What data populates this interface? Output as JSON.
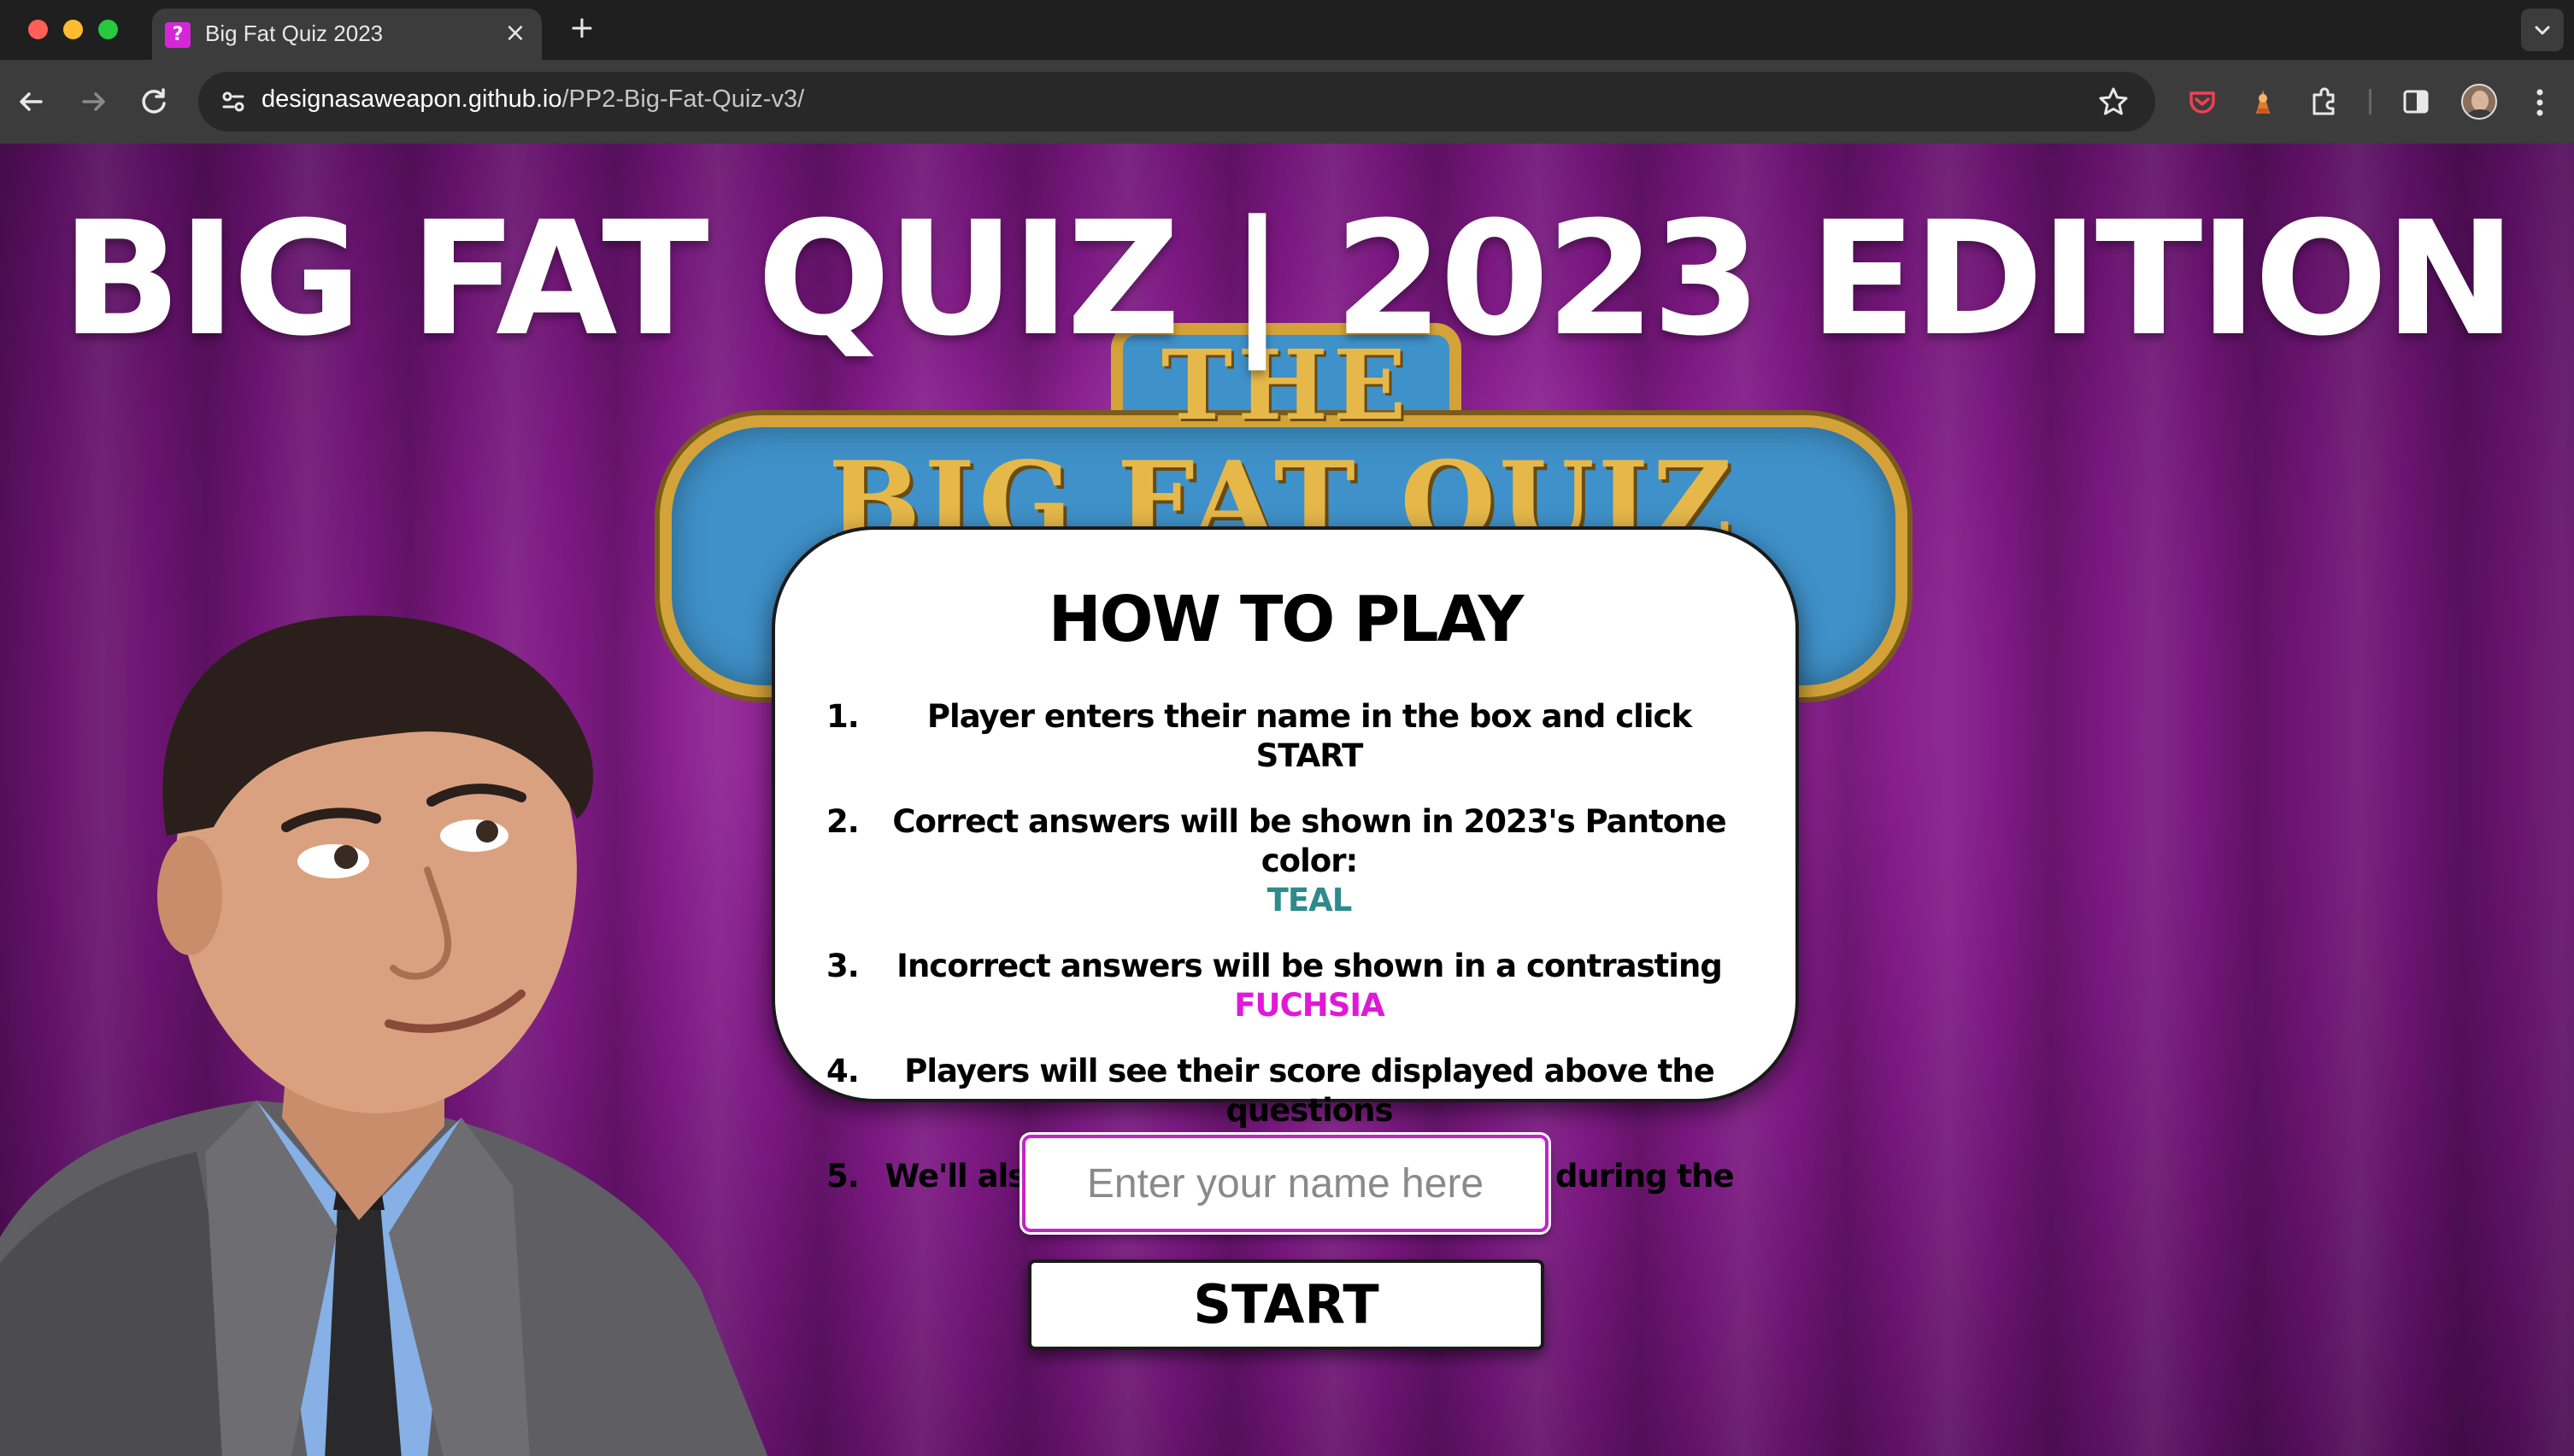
{
  "browser": {
    "tab_title": "Big Fat Quiz 2023",
    "tab_favicon_glyph": "?",
    "url_host": "designasaweapon.github.io",
    "url_path": "/PP2-Big-Fat-Quiz-v3/",
    "icons": [
      "back-icon",
      "forward-icon",
      "reload-icon",
      "site-info-icon",
      "star-icon",
      "pocket-icon",
      "extension-icon",
      "puzzle-icon",
      "sidebar-icon",
      "profile-avatar",
      "more-icon",
      "tab-close-icon",
      "new-tab-icon",
      "tab-list-icon"
    ]
  },
  "page": {
    "title": "BIG FAT QUIZ | 2023 EDITION",
    "logo": {
      "the": "THE",
      "name": "BIG FAT QUIZ"
    },
    "how_to_play": {
      "heading": "HOW TO PLAY",
      "rules": [
        {
          "num": "1.",
          "text": "Player enters their name in the box and click START"
        },
        {
          "num": "2.",
          "text": "Correct answers will be shown in 2023's Pantone color:",
          "highlight": "TEAL"
        },
        {
          "num": "3.",
          "text": "Incorrect answers will be shown in a contrasting",
          "highlight": "FUCHSIA"
        },
        {
          "num": "4.",
          "text": "Players will see their score displayed above the questions"
        },
        {
          "num": "5.",
          "text": "We'll also share some interesting facts during the quiz!"
        }
      ]
    },
    "name_input": {
      "placeholder": "Enter your name here",
      "value": ""
    },
    "start_button": "START"
  },
  "colors": {
    "teal": "#2f8a8c",
    "fuchsia": "#e018d8",
    "background": "#8a1b90"
  }
}
